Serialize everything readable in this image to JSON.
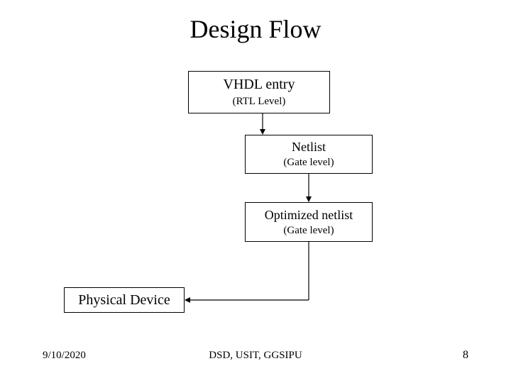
{
  "title": "Design Flow",
  "box1": {
    "line1": "VHDL entry",
    "line2": "(RTL Level)"
  },
  "box2": {
    "line1": "Netlist",
    "line2": "(Gate level)"
  },
  "box3": {
    "line1": "Optimized netlist",
    "line2": "(Gate level)"
  },
  "box4": {
    "line1": "Physical Device"
  },
  "footer": {
    "date": "9/10/2020",
    "center": "DSD, USIT, GGSIPU",
    "page": "8"
  }
}
